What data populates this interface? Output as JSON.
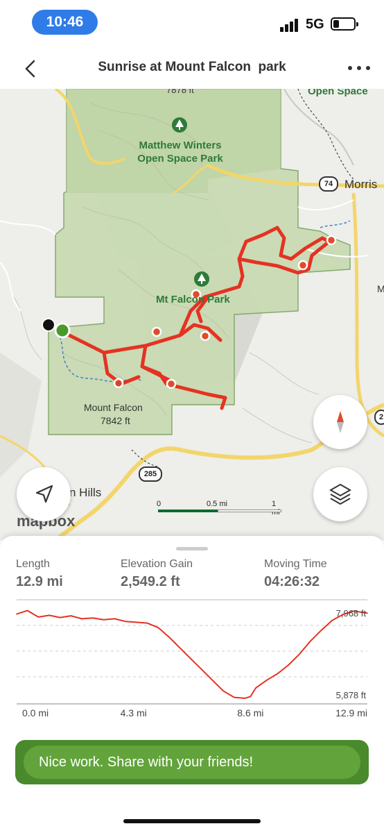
{
  "status_bar": {
    "time": "10:46",
    "network": "5G"
  },
  "header": {
    "title": "Sunrise at Mount Falcon  park"
  },
  "map": {
    "labels": {
      "top_elev": "7878 ft",
      "open_space_top": "Open Space",
      "park1": "Matthew Winters\nOpen Space Park",
      "park2": "Mt Falcon Park",
      "morrison": "Morris",
      "mount_falcon": "Mount Falcon",
      "mount_falcon_elev": "7842 ft",
      "hills": "n Hills",
      "edge_m": "M"
    },
    "shields": {
      "route74": "74",
      "route285": "285",
      "route_edge": "2"
    },
    "scale": {
      "zero": "0",
      "half": "0.5 mi",
      "one": "1 mi"
    },
    "attribution": "mapbox",
    "icons": {
      "locate": "navigation-arrow-icon",
      "layers": "layers-icon",
      "compass": "compass-icon"
    }
  },
  "stats": {
    "length": {
      "label": "Length",
      "value": "12.9 mi"
    },
    "elevation_gain": {
      "label": "Elevation Gain",
      "value": "2,549.2 ft"
    },
    "moving_time": {
      "label": "Moving Time",
      "value": "04:26:32"
    }
  },
  "chart_data": {
    "type": "line",
    "title": "",
    "xlabel": "",
    "ylabel": "",
    "x_ticks": [
      "0.0 mi",
      "4.3 mi",
      "8.6 mi",
      "12.9 mi"
    ],
    "y_annotations": [
      "7,968 ft",
      "5,878 ft"
    ],
    "xlim": [
      0,
      12.9
    ],
    "ylim": [
      5878,
      7968
    ],
    "series": [
      {
        "color": "#e53222",
        "x": [
          0.0,
          0.4,
          0.8,
          1.2,
          1.6,
          2.0,
          2.4,
          2.8,
          3.2,
          3.6,
          4.0,
          4.4,
          4.8,
          5.2,
          5.6,
          6.0,
          6.4,
          6.8,
          7.2,
          7.6,
          8.0,
          8.4,
          8.6,
          8.8,
          9.2,
          9.6,
          10.0,
          10.4,
          10.8,
          11.2,
          11.6,
          12.0,
          12.4,
          12.9
        ],
        "y": [
          7830,
          7910,
          7760,
          7800,
          7750,
          7790,
          7720,
          7740,
          7700,
          7720,
          7660,
          7640,
          7620,
          7520,
          7300,
          7050,
          6800,
          6550,
          6300,
          6050,
          5900,
          5880,
          5920,
          6120,
          6300,
          6450,
          6650,
          6900,
          7200,
          7450,
          7680,
          7820,
          7900,
          7850
        ]
      }
    ],
    "grid": true
  },
  "cta": {
    "label": "Nice work. Share with your friends!"
  }
}
